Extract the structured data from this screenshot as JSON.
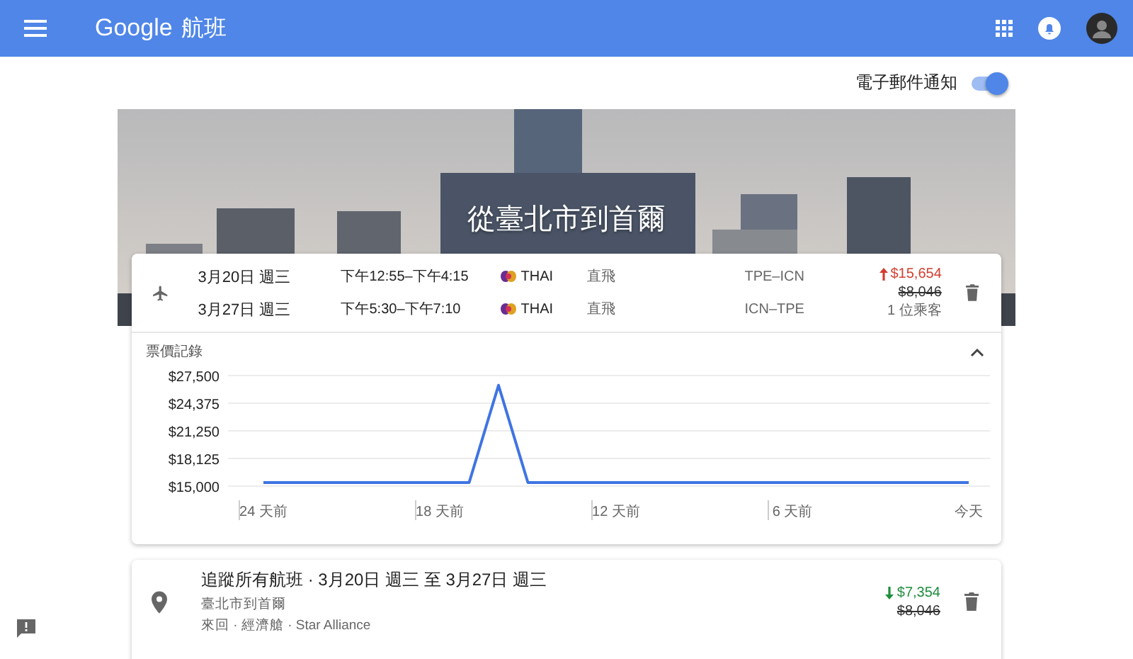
{
  "app_bar": {
    "logo": "Google",
    "title": "航班"
  },
  "email_notifications": {
    "label": "電子郵件通知",
    "on": true
  },
  "hero": {
    "title": "從臺北市到首爾"
  },
  "tracked_trip": {
    "legs": [
      {
        "date": "3月20日 週三",
        "time": "下午12:55–下午4:15",
        "airline": "THAI",
        "stops": "直飛",
        "route": "TPE–ICN"
      },
      {
        "date": "3月27日 週三",
        "time": "下午5:30–下午7:10",
        "airline": "THAI",
        "stops": "直飛",
        "route": "ICN–TPE"
      }
    ],
    "price": {
      "rising": true,
      "current": "$15,654",
      "original": "$8,046",
      "passengers": "1 位乘客"
    },
    "history": {
      "title": "票價記錄",
      "expanded": true,
      "chart_data": {
        "type": "line",
        "categories": [
          "24 天前",
          null,
          null,
          null,
          null,
          null,
          "18 天前",
          null,
          null,
          null,
          null,
          null,
          "12 天前",
          null,
          null,
          null,
          null,
          null,
          "6 天前",
          null,
          null,
          null,
          null,
          null,
          "今天"
        ],
        "series": [
          {
            "color": "#3f74e3",
            "values": [
              15400,
              15400,
              15400,
              15400,
              15400,
              15400,
              15400,
              15400,
              26400,
              15400,
              15400,
              15400,
              15400,
              15400,
              15400,
              15400,
              15400,
              15400,
              15400,
              15400,
              15400,
              15400,
              15400,
              15400,
              15400
            ]
          }
        ],
        "ylim": [
          15000,
          27500
        ],
        "grid": true,
        "yticks": [
          {
            "value": 15000,
            "label": "$15,000"
          },
          {
            "value": 18125,
            "label": "$18,125"
          },
          {
            "value": 21250,
            "label": "$21,250"
          },
          {
            "value": 24375,
            "label": "$24,375"
          },
          {
            "value": 27500,
            "label": "$27,500"
          }
        ]
      }
    }
  },
  "tracked_search": {
    "title": "追蹤所有航班 · 3月20日 週三 至 3月27日 週三",
    "subtitle": "臺北市到首爾",
    "details": "來回 · 經濟艙 · Star Alliance",
    "price": {
      "rising": false,
      "current": "$7,354",
      "original": "$8,046"
    }
  }
}
